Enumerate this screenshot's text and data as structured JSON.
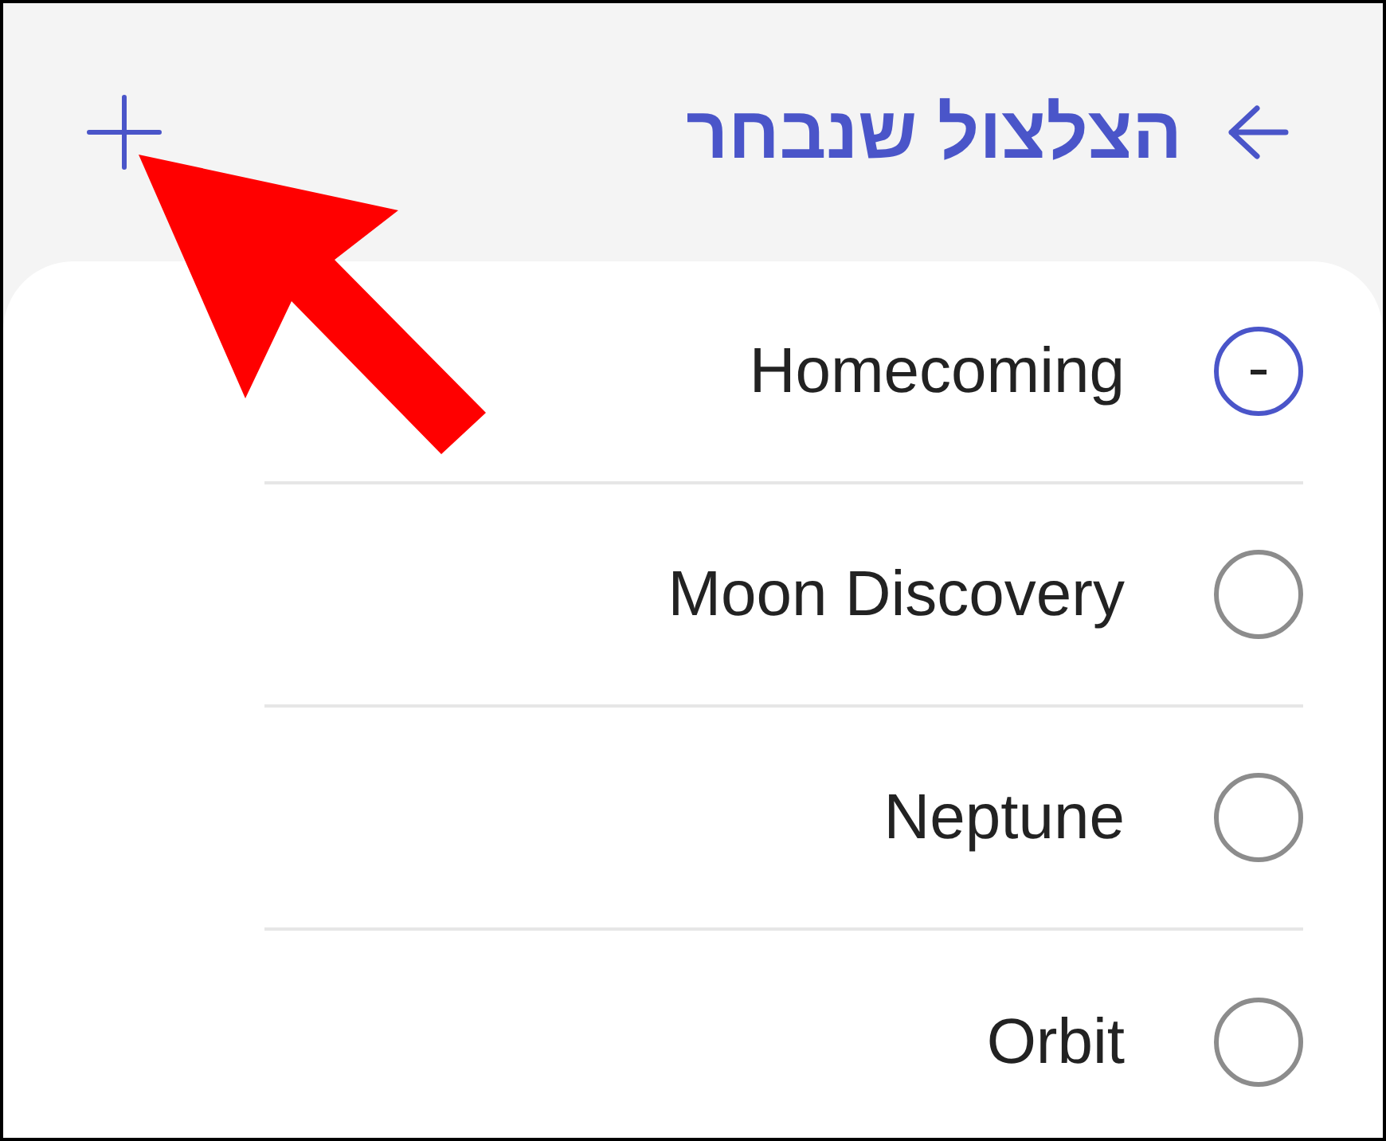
{
  "header": {
    "title": "הצלצול שנבחר"
  },
  "ringtones": [
    {
      "name": "Homecoming",
      "selected": true
    },
    {
      "name": "Moon Discovery",
      "selected": false
    },
    {
      "name": "Neptune",
      "selected": false
    },
    {
      "name": "Orbit",
      "selected": false
    }
  ]
}
